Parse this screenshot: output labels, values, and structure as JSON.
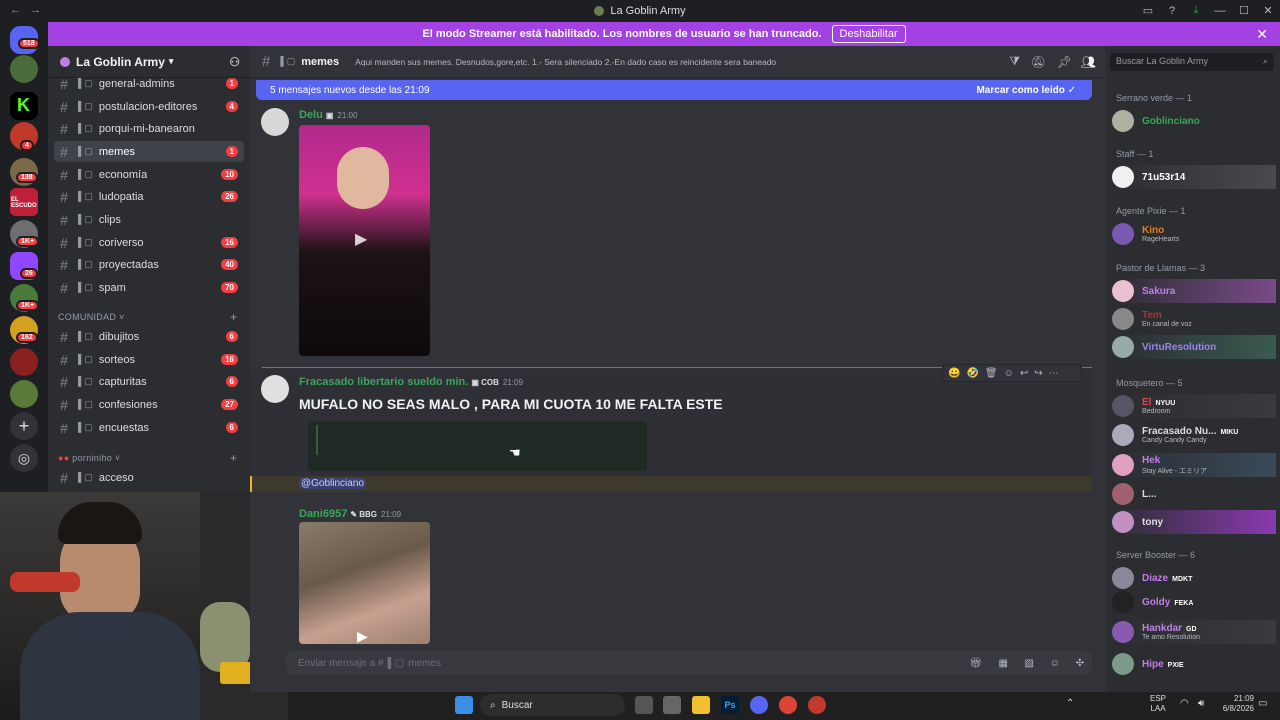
{
  "window": {
    "title": "La Goblin Army"
  },
  "banner": {
    "text": "El modo Streamer está habilitado. Los nombres de usuario se han truncado.",
    "button": "Deshabilitar"
  },
  "rail": {
    "badges": [
      "518",
      "4",
      "138",
      "1K+",
      "26",
      "1K+",
      "162"
    ],
    "logo_text": "EL ESCUDO"
  },
  "guild": {
    "name": "La Goblin Army"
  },
  "channels": [
    {
      "name": "general-admins",
      "count": "1"
    },
    {
      "name": "postulacion-editores",
      "count": "4"
    },
    {
      "name": "porqui-mi-banearon",
      "count": ""
    },
    {
      "name": "memes",
      "count": "1"
    },
    {
      "name": "economía",
      "count": "10"
    },
    {
      "name": "ludopatia",
      "count": "26"
    },
    {
      "name": "clips",
      "count": ""
    },
    {
      "name": "coriverso",
      "count": "16"
    },
    {
      "name": "proyectadas",
      "count": "40"
    },
    {
      "name": "spam",
      "count": "70"
    }
  ],
  "category_comunidad": "COMUNIDAD",
  "channels2": [
    {
      "name": "dibujitos",
      "count": "6"
    },
    {
      "name": "sorteos",
      "count": "16"
    },
    {
      "name": "capturitas",
      "count": "6"
    },
    {
      "name": "confesiones",
      "count": "27"
    },
    {
      "name": "encuestas",
      "count": "6"
    }
  ],
  "category_porno": "porniniho",
  "channel_acceso": "acceso",
  "chat": {
    "channel": "memes",
    "topic": "Aqui manden sus memes. Desnudos,gore,etc. 1.- Sera silenciado 2.-En dado caso es reincidente sera baneado",
    "newbar_left": "5 mensajes nuevos desde las 21:09",
    "newbar_right": "Marcar como leído",
    "messages": [
      {
        "user": "Delu",
        "time": "21:00",
        "color": "#3ba55c"
      },
      {
        "user": "Fracasado libertario sueldo min.",
        "tag": "COB",
        "time": "21:09",
        "text": "MUFALO NO SEAS MALO , PARA MI CUOTA 10 ME FALTA ESTE",
        "mention": "@Goblinciano",
        "color": "#3ba55c"
      },
      {
        "user": "Dani6957",
        "tag": "BBG",
        "time": "21:09",
        "color": "#3ba55c"
      }
    ],
    "composer_placeholder": "Enviar mensaje a #",
    "composer_channel": "memes"
  },
  "members": {
    "search": "Buscar La Goblin Army",
    "groups": [
      {
        "title": "Serrano verde — 1"
      },
      {
        "title": "Staff — 1"
      },
      {
        "title": "Agente Pixie — 1"
      },
      {
        "title": "Pastor de Llamas — 3"
      },
      {
        "title": "Mosquetero — 5"
      },
      {
        "title": "Server Booster — 6"
      }
    ],
    "list": [
      {
        "name": "Goblinciano",
        "status": "",
        "color": "#3ba55c"
      },
      {
        "name": "71u53r14",
        "status": "",
        "color": "#ffffff"
      },
      {
        "name": "Kino",
        "status": "RageHearts",
        "color": "#e67e22"
      },
      {
        "name": "Sakura",
        "status": "",
        "color": "#c27ee8"
      },
      {
        "name": "Tem",
        "status": "En canal de voz",
        "color": "#ed4245"
      },
      {
        "name": "VirtuResolution",
        "status": "",
        "color": "#9b84ee"
      },
      {
        "name": "El",
        "tag": "NYUU",
        "status": "Bedroom",
        "color": "#ed4245"
      },
      {
        "name": "Fracasado Nu...",
        "tag": "MIKU",
        "status": "Candy Candy Candy",
        "color": "#dbdee1"
      },
      {
        "name": "Hek",
        "status": "Stay Alive - エミリア",
        "color": "#c27ee8"
      },
      {
        "name": "L...",
        "status": "",
        "color": "#dbdee1"
      },
      {
        "name": "tony",
        "status": "",
        "color": "#dbdee1"
      },
      {
        "name": "Diaze",
        "tag": "MDKT",
        "status": "",
        "color": "#c27ee8"
      },
      {
        "name": "Goldy",
        "tag": "FEKA",
        "status": "",
        "color": "#c27ee8"
      },
      {
        "name": "Hankdar",
        "tag": "GD",
        "status": "Te amo Resolution",
        "color": "#c27ee8"
      },
      {
        "name": "Hipe",
        "tag": "PXIE",
        "status": "",
        "color": "#c27ee8"
      }
    ]
  },
  "taskbar": {
    "search": "Buscar",
    "lang": "ESP",
    "lang2": "LAA",
    "time": "21:09",
    "date": "6/8/2026"
  }
}
